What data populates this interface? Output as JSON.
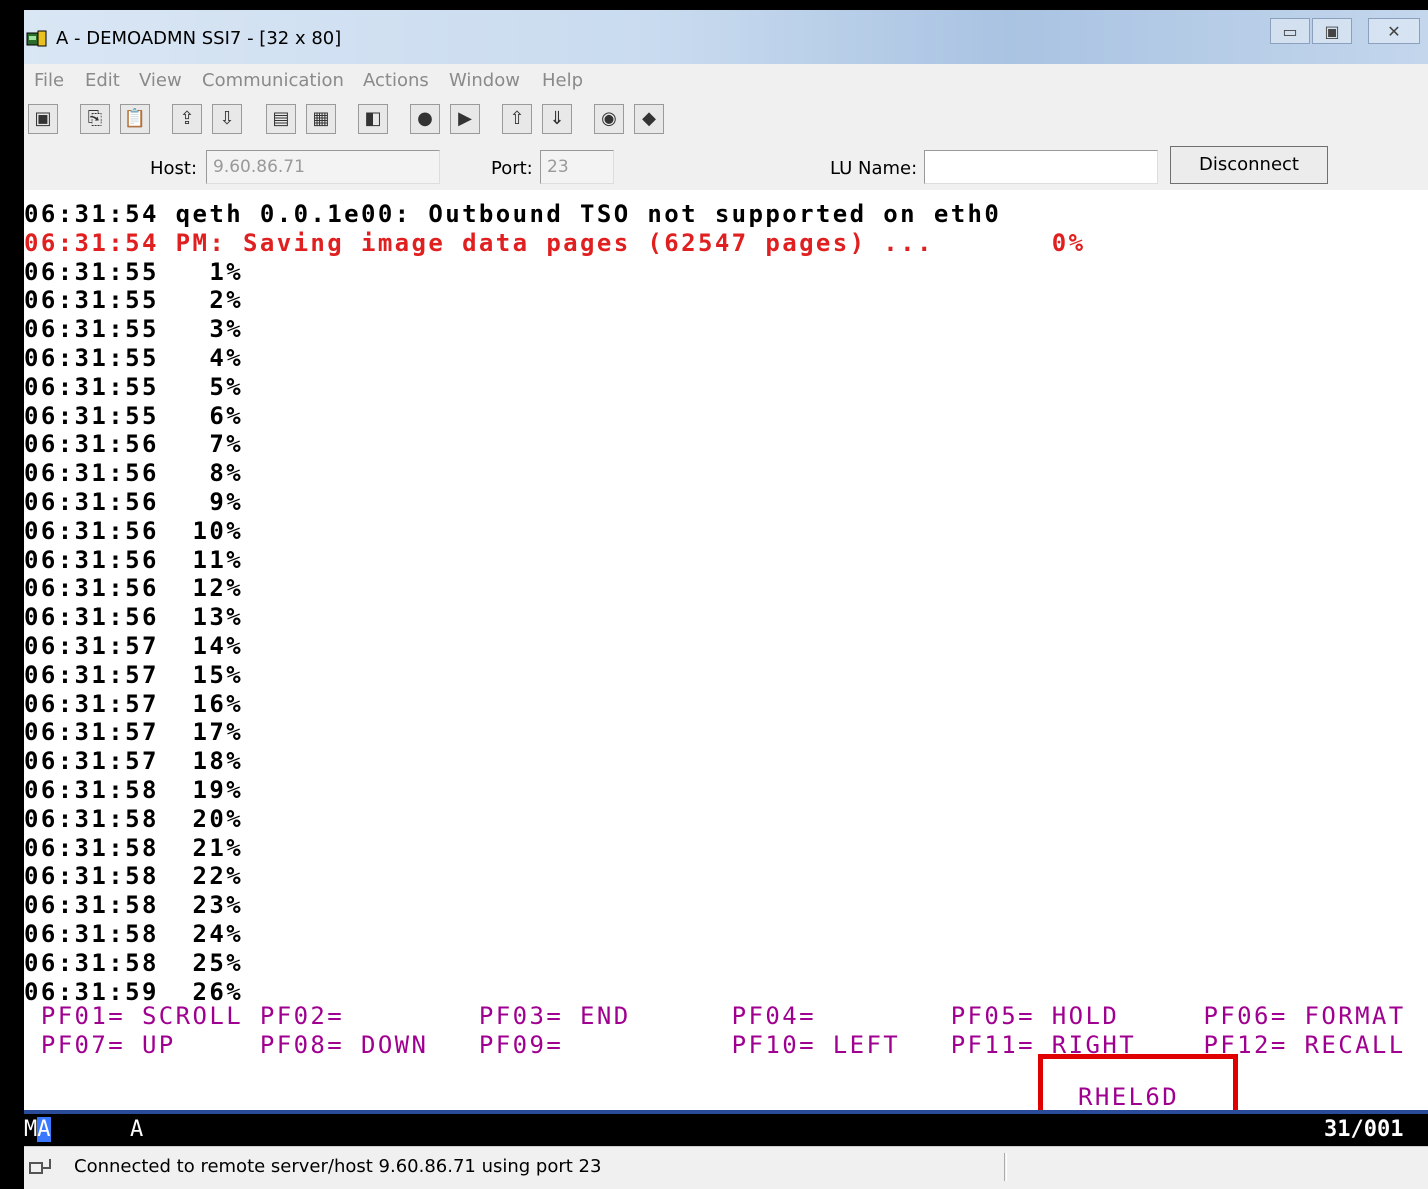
{
  "window": {
    "title": "A - DEMOADMN SSI7 - [32 x 80]",
    "controls": [
      "▭",
      "▣",
      "✕"
    ]
  },
  "menu": [
    "File",
    "Edit",
    "View",
    "Communication",
    "Actions",
    "Window",
    "Help"
  ],
  "toolbar": {
    "icons": [
      "print-screen-icon",
      "copy-icon",
      "paste-icon",
      "send-icon",
      "receive-icon",
      "display-icon",
      "display2-icon",
      "macro-icon",
      "record-icon",
      "play-icon",
      "transfer-up-icon",
      "transfer-down-icon",
      "globe-icon",
      "tag-icon"
    ]
  },
  "connection": {
    "host_label": "Host:",
    "host_value": "9.60.86.71",
    "port_label": "Port:",
    "port_value": "23",
    "lu_label": "LU Name:",
    "lu_value": "",
    "disconnect_label": "Disconnect"
  },
  "terminal": {
    "lines": [
      {
        "text": "06:31:54 qeth 0.0.1e00: Outbound TSO not supported on eth0",
        "color": "black"
      },
      {
        "text": "06:31:54 PM: Saving image data pages (62547 pages) ...       0%",
        "color": "red"
      },
      {
        "text": "06:31:55   1%",
        "color": "black"
      },
      {
        "text": "06:31:55   2%",
        "color": "black"
      },
      {
        "text": "06:31:55   3%",
        "color": "black"
      },
      {
        "text": "06:31:55   4%",
        "color": "black"
      },
      {
        "text": "06:31:55   5%",
        "color": "black"
      },
      {
        "text": "06:31:55   6%",
        "color": "black"
      },
      {
        "text": "06:31:56   7%",
        "color": "black"
      },
      {
        "text": "06:31:56   8%",
        "color": "black"
      },
      {
        "text": "06:31:56   9%",
        "color": "black"
      },
      {
        "text": "06:31:56  10%",
        "color": "black"
      },
      {
        "text": "06:31:56  11%",
        "color": "black"
      },
      {
        "text": "06:31:56  12%",
        "color": "black"
      },
      {
        "text": "06:31:56  13%",
        "color": "black"
      },
      {
        "text": "06:31:57  14%",
        "color": "black"
      },
      {
        "text": "06:31:57  15%",
        "color": "black"
      },
      {
        "text": "06:31:57  16%",
        "color": "black"
      },
      {
        "text": "06:31:57  17%",
        "color": "black"
      },
      {
        "text": "06:31:57  18%",
        "color": "black"
      },
      {
        "text": "06:31:58  19%",
        "color": "black"
      },
      {
        "text": "06:31:58  20%",
        "color": "black"
      },
      {
        "text": "06:31:58  21%",
        "color": "black"
      },
      {
        "text": "06:31:58  22%",
        "color": "black"
      },
      {
        "text": "06:31:58  23%",
        "color": "black"
      },
      {
        "text": "06:31:58  24%",
        "color": "black"
      },
      {
        "text": "06:31:58  25%",
        "color": "black"
      },
      {
        "text": "06:31:59  26%",
        "color": "black"
      }
    ],
    "pf_lines": [
      " PF01= SCROLL PF02=        PF03= END      PF04=        PF05= HOLD     PF06= FORMAT",
      " PF07= UP     PF08= DOWN   PF09=          PF10= LEFT   PF11= RIGHT    PF12= RECALL"
    ],
    "system_name": "RHEL6D"
  },
  "oia": {
    "mode": "MA",
    "session": "A",
    "cursor_pos": "31/001"
  },
  "status": {
    "text": "Connected to remote server/host 9.60.86.71 using port 23"
  },
  "colors": {
    "terminal_red": "#e02020",
    "pf_magenta": "#a00090",
    "highlight": "#e00000"
  }
}
